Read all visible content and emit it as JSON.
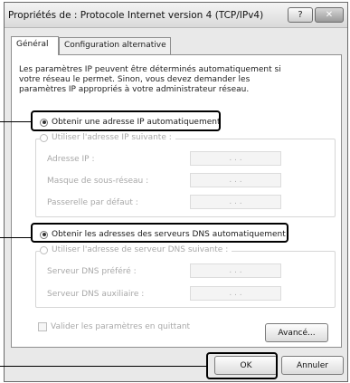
{
  "window": {
    "title": "Propriétés de : Protocole Internet version 4 (TCP/IPv4)",
    "help_label": "?",
    "close_label": "✕"
  },
  "tabs": [
    {
      "label": "Général",
      "active": true
    },
    {
      "label": "Configuration alternative",
      "active": false
    }
  ],
  "intro_text": "Les paramètres IP peuvent être déterminés automatiquement si votre réseau le permet. Sinon, vous devez demander les paramètres IP appropriés à votre administrateur réseau.",
  "ip_section": {
    "auto_label": "Obtenir une adresse IP automatiquement",
    "auto_checked": true,
    "manual_label": "Utiliser l'adresse IP suivante :",
    "fields": [
      {
        "label": "Adresse IP :",
        "value": ". . ."
      },
      {
        "label": "Masque de sous-réseau :",
        "value": ". . ."
      },
      {
        "label": "Passerelle par défaut :",
        "value": ". . ."
      }
    ]
  },
  "dns_section": {
    "auto_label": "Obtenir les adresses des serveurs DNS automatiquement",
    "auto_checked": true,
    "manual_label": "Utiliser l'adresse de serveur DNS suivante :",
    "fields": [
      {
        "label": "Serveur DNS préféré :",
        "value": ". . ."
      },
      {
        "label": "Serveur DNS auxiliaire :",
        "value": ". . ."
      }
    ]
  },
  "validate_label": "Valider les paramètres en quittant",
  "buttons": {
    "advanced": "Avancé...",
    "ok": "OK",
    "cancel": "Annuler"
  }
}
